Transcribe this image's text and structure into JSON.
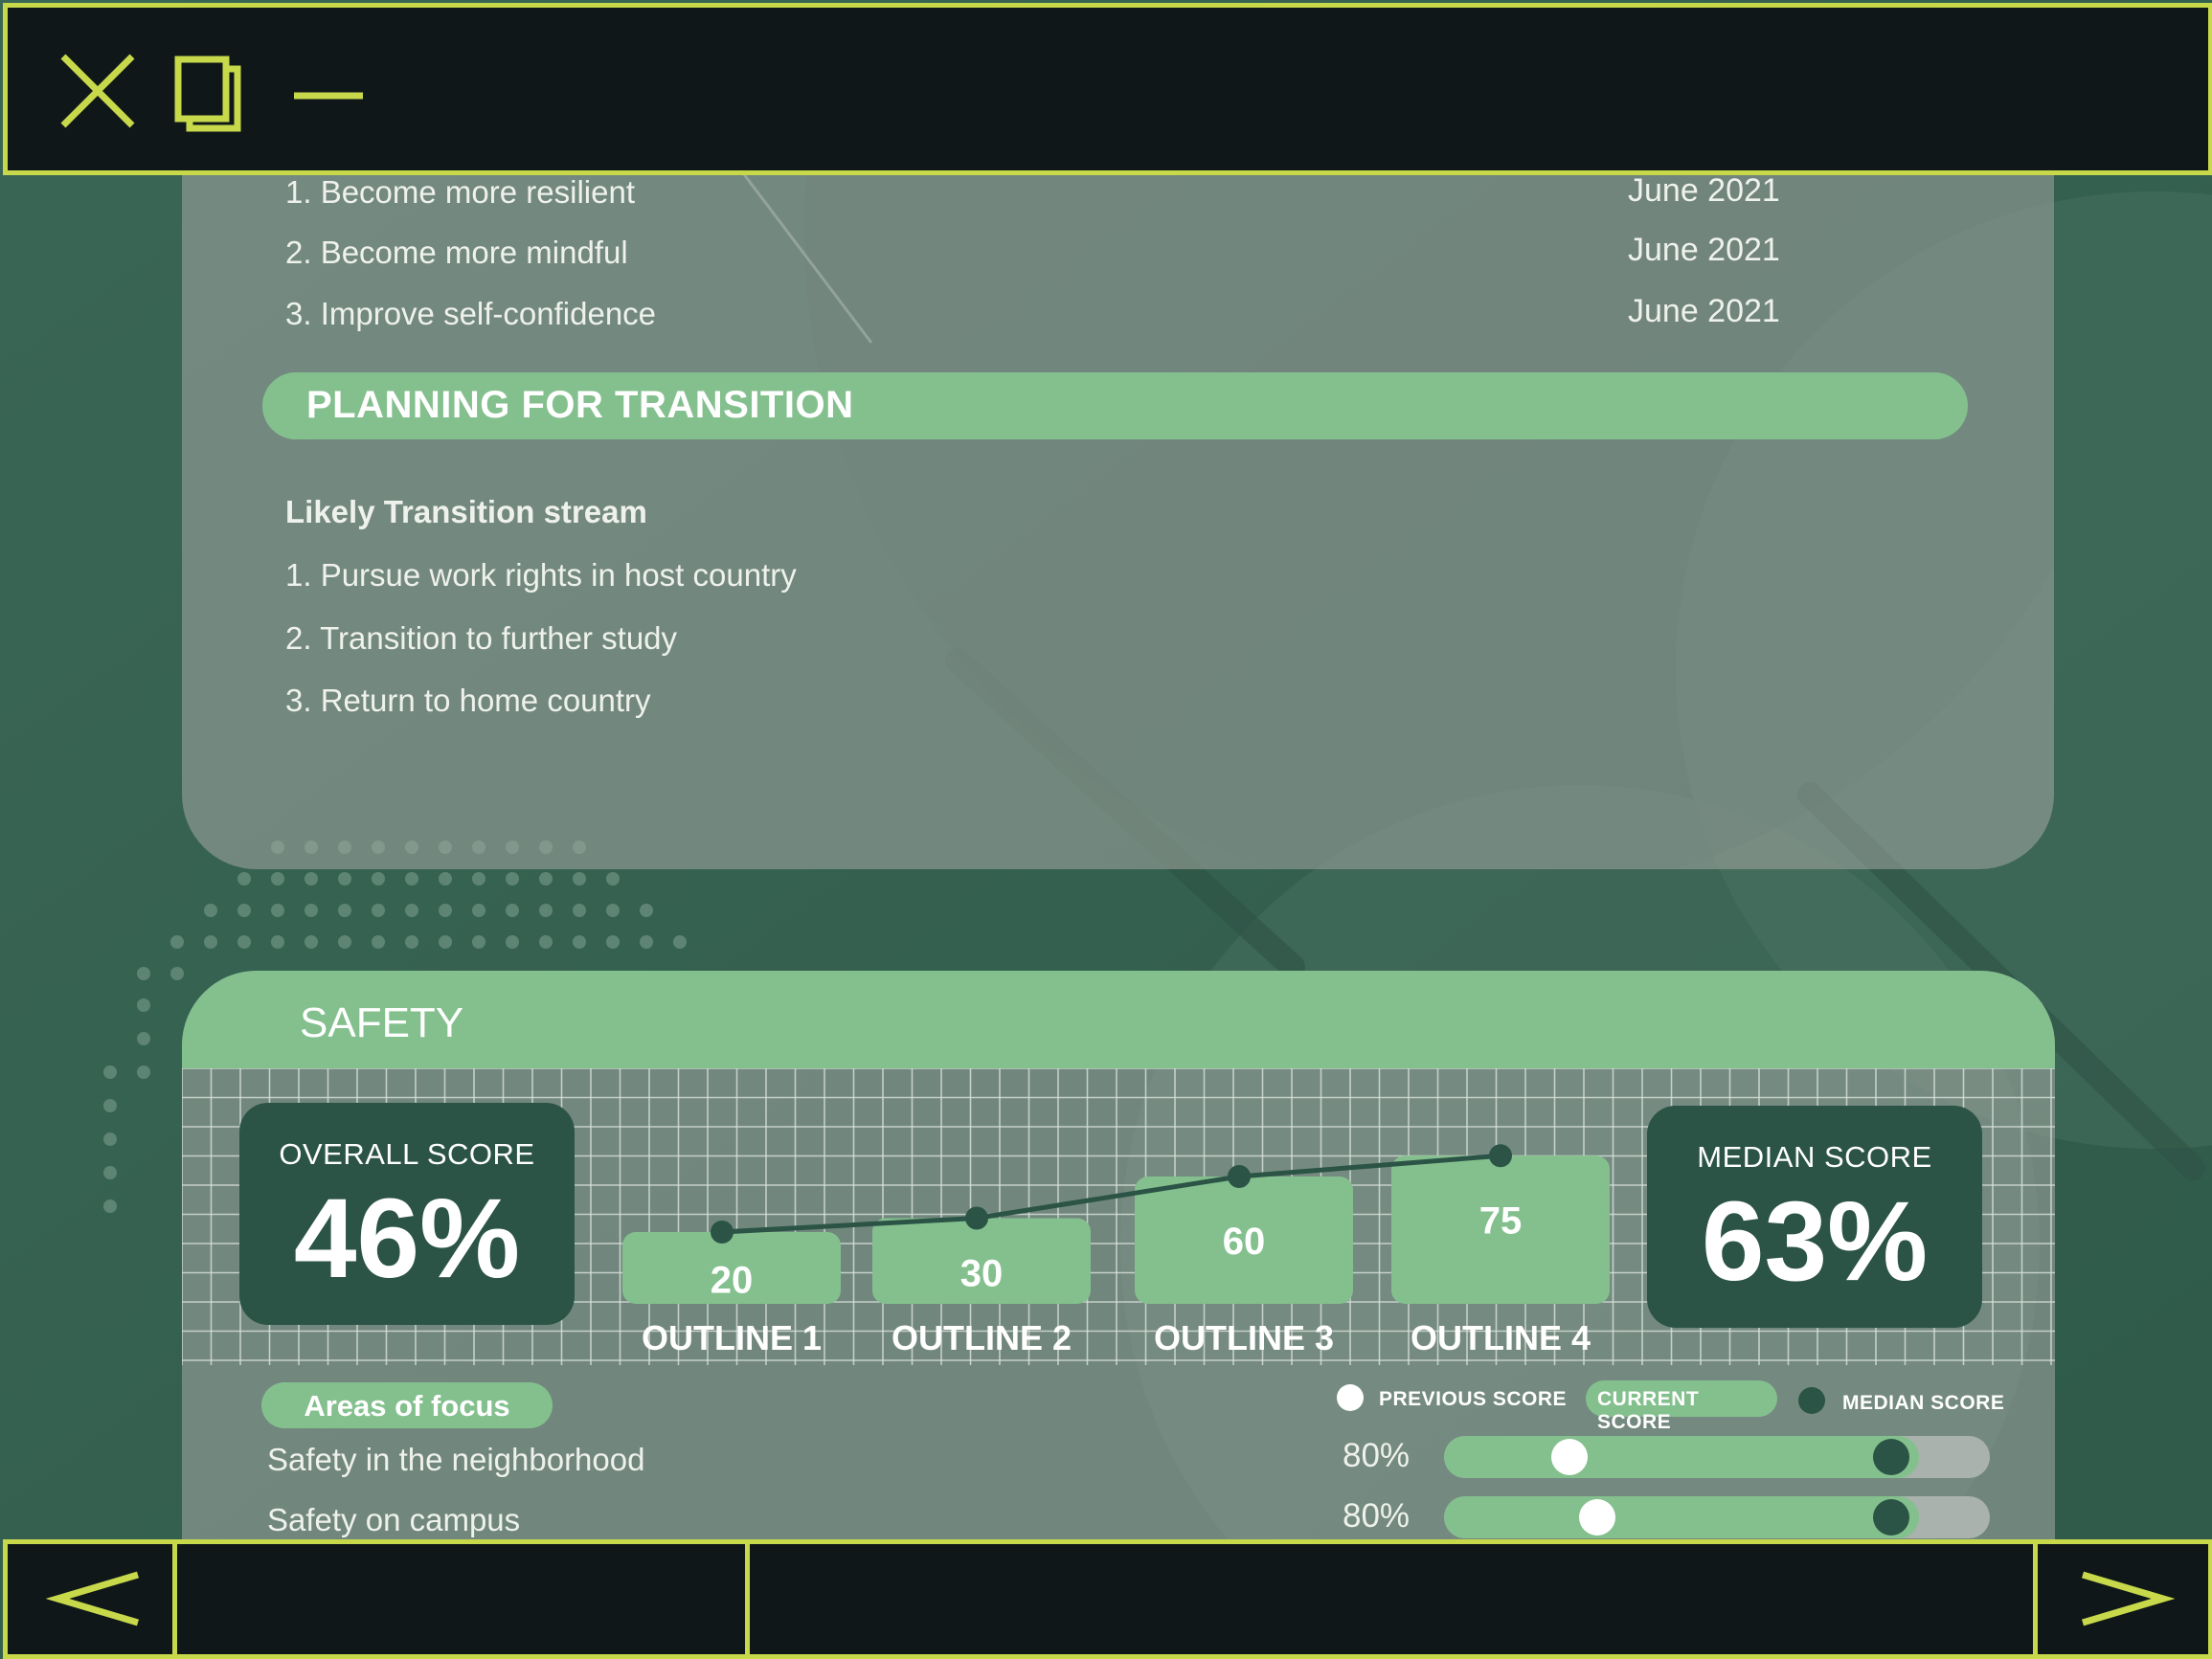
{
  "goals": [
    {
      "label": "1. Become more resilient",
      "date": "June 2021"
    },
    {
      "label": "2. Become more mindful",
      "date": "June 2021"
    },
    {
      "label": "3. Improve self-confidence",
      "date": "June 2021"
    }
  ],
  "transition": {
    "section_title": "PLANNING FOR TRANSITION",
    "stream_heading": "Likely Transition stream",
    "items": [
      "1. Pursue work rights in host country",
      "2. Transition to further study",
      "3. Return to home country"
    ]
  },
  "safety": {
    "title": "SAFETY",
    "overall_label": "OVERALL SCORE",
    "overall_value": "46%",
    "median_label": "MEDIAN SCORE",
    "median_value": "63%",
    "areas_label": "Areas of focus",
    "legend": {
      "previous": "PREVIOUS SCORE",
      "current": "CURRENT SCORE",
      "median": "MEDIAN SCORE"
    },
    "focus_rows": [
      {
        "label": "Safety in the neighborhood",
        "pct": "80%",
        "current": 0.87,
        "previous": 0.23,
        "median": 0.82
      },
      {
        "label": "Safety on campus",
        "pct": "80%",
        "current": 0.87,
        "previous": 0.28,
        "median": 0.82
      }
    ]
  },
  "chart_data": {
    "type": "bar",
    "categories": [
      "OUTLINE 1",
      "OUTLINE 2",
      "OUTLINE 3",
      "OUTLINE 4"
    ],
    "values": [
      20,
      30,
      60,
      75
    ],
    "series": [
      {
        "values": [
          20,
          30,
          60,
          75
        ]
      }
    ],
    "overlay": "line",
    "grid": true
  },
  "colors": {
    "accent": "#c7d84a",
    "green": "#84c08e",
    "dark_green": "#2b5446",
    "chrome": "#0f1719"
  },
  "icons": {
    "close": "close-icon",
    "restore": "restore-icon",
    "minimize": "minimize-icon",
    "prev": "chevron-left-icon",
    "next": "chevron-right-icon"
  }
}
